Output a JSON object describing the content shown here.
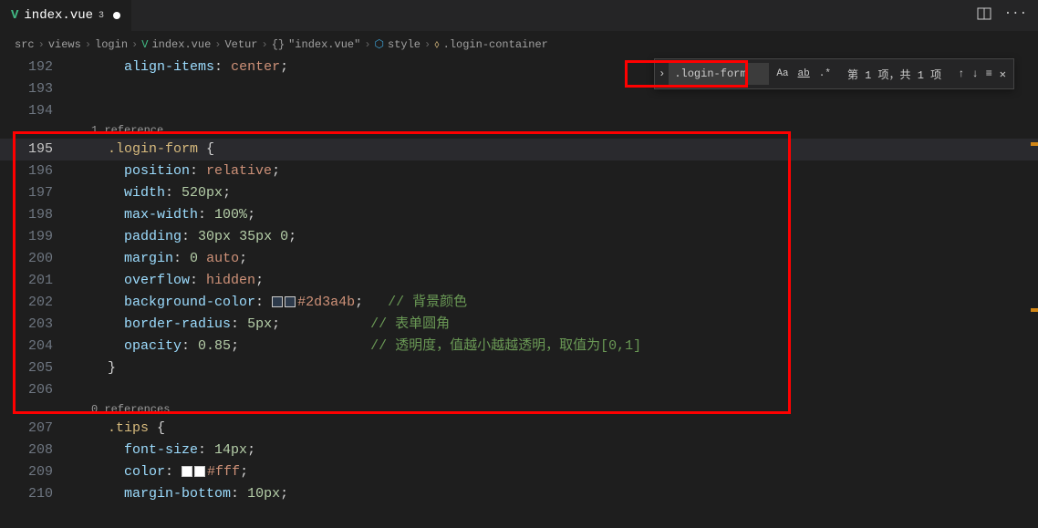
{
  "tab": {
    "icon": "V",
    "name": "index.vue",
    "badge": "3"
  },
  "breadcrumb": {
    "parts": [
      "src",
      "views",
      "login",
      "index.vue",
      "Vetur",
      "\"index.vue\"",
      "style",
      ".login-container"
    ]
  },
  "find": {
    "value": ".login-form",
    "results": "第 1 项，共 1 项",
    "opt_aa": "Aa",
    "opt_ab": "ab",
    "opt_re": ".*"
  },
  "codelens": {
    "ref1": "1 reference",
    "ref0": "0 references"
  },
  "lines": {
    "192": {
      "num": "192",
      "content": [
        {
          "t": "    ",
          "c": ""
        },
        {
          "t": "align-items",
          "c": "prop"
        },
        {
          "t": ": ",
          "c": "punct"
        },
        {
          "t": "center",
          "c": "val"
        },
        {
          "t": ";",
          "c": "punct"
        }
      ]
    },
    "193": {
      "num": "193",
      "content": []
    },
    "194": {
      "num": "194",
      "content": []
    },
    "195": {
      "num": "195",
      "content": [
        {
          "t": "  ",
          "c": ""
        },
        {
          "t": ".login-form",
          "c": "sel"
        },
        {
          "t": " {",
          "c": "punct"
        }
      ]
    },
    "196": {
      "num": "196",
      "content": [
        {
          "t": "    ",
          "c": ""
        },
        {
          "t": "position",
          "c": "prop"
        },
        {
          "t": ": ",
          "c": "punct"
        },
        {
          "t": "relative",
          "c": "val"
        },
        {
          "t": ";",
          "c": "punct"
        }
      ]
    },
    "197": {
      "num": "197",
      "content": [
        {
          "t": "    ",
          "c": ""
        },
        {
          "t": "width",
          "c": "prop"
        },
        {
          "t": ": ",
          "c": "punct"
        },
        {
          "t": "520px",
          "c": "num"
        },
        {
          "t": ";",
          "c": "punct"
        }
      ]
    },
    "198": {
      "num": "198",
      "content": [
        {
          "t": "    ",
          "c": ""
        },
        {
          "t": "max-width",
          "c": "prop"
        },
        {
          "t": ": ",
          "c": "punct"
        },
        {
          "t": "100%",
          "c": "num"
        },
        {
          "t": ";",
          "c": "punct"
        }
      ]
    },
    "199": {
      "num": "199",
      "content": [
        {
          "t": "    ",
          "c": ""
        },
        {
          "t": "padding",
          "c": "prop"
        },
        {
          "t": ": ",
          "c": "punct"
        },
        {
          "t": "30px",
          "c": "num"
        },
        {
          "t": " ",
          "c": ""
        },
        {
          "t": "35px",
          "c": "num"
        },
        {
          "t": " ",
          "c": ""
        },
        {
          "t": "0",
          "c": "num"
        },
        {
          "t": ";",
          "c": "punct"
        }
      ]
    },
    "200": {
      "num": "200",
      "content": [
        {
          "t": "    ",
          "c": ""
        },
        {
          "t": "margin",
          "c": "prop"
        },
        {
          "t": ": ",
          "c": "punct"
        },
        {
          "t": "0",
          "c": "num"
        },
        {
          "t": " ",
          "c": ""
        },
        {
          "t": "auto",
          "c": "val"
        },
        {
          "t": ";",
          "c": "punct"
        }
      ]
    },
    "201": {
      "num": "201",
      "content": [
        {
          "t": "    ",
          "c": ""
        },
        {
          "t": "overflow",
          "c": "prop"
        },
        {
          "t": ": ",
          "c": "punct"
        },
        {
          "t": "hidden",
          "c": "val"
        },
        {
          "t": ";",
          "c": "punct"
        }
      ]
    },
    "202": {
      "num": "202",
      "swatches": [
        "#2d3a4b",
        "#2d3a4b"
      ],
      "content_pre": [
        {
          "t": "    ",
          "c": ""
        },
        {
          "t": "background-color",
          "c": "prop"
        },
        {
          "t": ": ",
          "c": "punct"
        }
      ],
      "content_post": [
        {
          "t": "#2d3a4b",
          "c": "hex"
        },
        {
          "t": ";",
          "c": "punct"
        },
        {
          "t": "   ",
          "c": ""
        },
        {
          "t": "// 背景颜色",
          "c": "comment"
        }
      ]
    },
    "203": {
      "num": "203",
      "content": [
        {
          "t": "    ",
          "c": ""
        },
        {
          "t": "border-radius",
          "c": "prop"
        },
        {
          "t": ": ",
          "c": "punct"
        },
        {
          "t": "5px",
          "c": "num"
        },
        {
          "t": ";",
          "c": "punct"
        },
        {
          "t": "           ",
          "c": ""
        },
        {
          "t": "// 表单圆角",
          "c": "comment"
        }
      ]
    },
    "204": {
      "num": "204",
      "content": [
        {
          "t": "    ",
          "c": ""
        },
        {
          "t": "opacity",
          "c": "prop"
        },
        {
          "t": ": ",
          "c": "punct"
        },
        {
          "t": "0.85",
          "c": "num"
        },
        {
          "t": ";",
          "c": "punct"
        },
        {
          "t": "                ",
          "c": ""
        },
        {
          "t": "// 透明度，值越小越越透明，取值为[0,1]",
          "c": "comment"
        }
      ]
    },
    "205": {
      "num": "205",
      "content": [
        {
          "t": "  ",
          "c": ""
        },
        {
          "t": "}",
          "c": "punct"
        }
      ]
    },
    "206": {
      "num": "206",
      "content": []
    },
    "207": {
      "num": "207",
      "content": [
        {
          "t": "  ",
          "c": ""
        },
        {
          "t": ".tips",
          "c": "sel"
        },
        {
          "t": " {",
          "c": "punct"
        }
      ]
    },
    "208": {
      "num": "208",
      "content": [
        {
          "t": "    ",
          "c": ""
        },
        {
          "t": "font-size",
          "c": "prop"
        },
        {
          "t": ": ",
          "c": "punct"
        },
        {
          "t": "14px",
          "c": "num"
        },
        {
          "t": ";",
          "c": "punct"
        }
      ]
    },
    "209": {
      "num": "209",
      "swatches": [
        "#fff",
        "#fff"
      ],
      "content_pre": [
        {
          "t": "    ",
          "c": ""
        },
        {
          "t": "color",
          "c": "prop"
        },
        {
          "t": ": ",
          "c": "punct"
        }
      ],
      "content_post": [
        {
          "t": "#fff",
          "c": "hex"
        },
        {
          "t": ";",
          "c": "punct"
        }
      ]
    },
    "210": {
      "num": "210",
      "content": [
        {
          "t": "    ",
          "c": ""
        },
        {
          "t": "margin-bottom",
          "c": "prop"
        },
        {
          "t": ": ",
          "c": "punct"
        },
        {
          "t": "10px",
          "c": "num"
        },
        {
          "t": ";",
          "c": "punct"
        }
      ]
    }
  },
  "line_order": [
    "192",
    "193",
    "194",
    "CL1",
    "195",
    "196",
    "197",
    "198",
    "199",
    "200",
    "201",
    "202",
    "203",
    "204",
    "205",
    "206",
    "CL0",
    "207",
    "208",
    "209",
    "210"
  ]
}
